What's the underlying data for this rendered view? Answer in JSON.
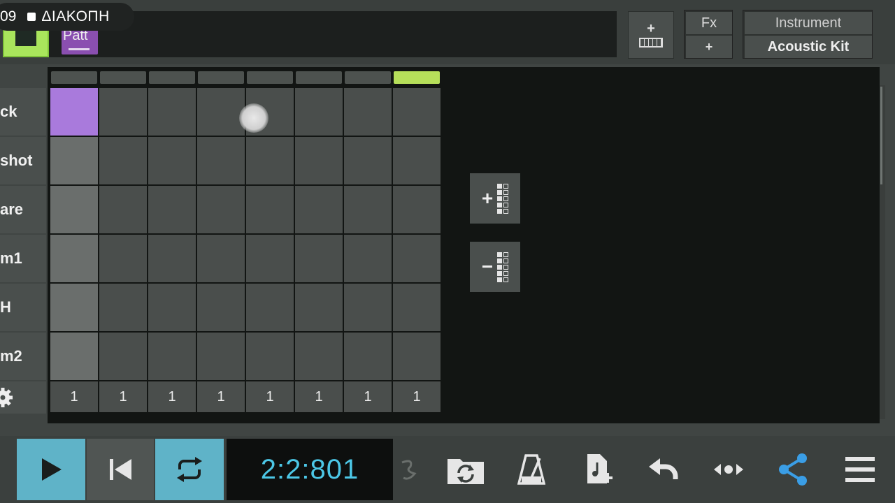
{
  "status": {
    "time": "09",
    "recording_label": "ΔΙΑΚΟΠΗ"
  },
  "pattern": {
    "chip_label": "Patt"
  },
  "header": {
    "keyboard_plus": "+",
    "fx_label": "Fx",
    "fx_plus": "+",
    "instrument_label": "Instrument",
    "instrument_name": "Acoustic Kit"
  },
  "tracks": [
    {
      "label": "ck"
    },
    {
      "label": "shot"
    },
    {
      "label": "are"
    },
    {
      "label": "m1"
    },
    {
      "label": "H"
    },
    {
      "label": "m2"
    }
  ],
  "steps": {
    "count": 8,
    "active_step": 8
  },
  "velocity_values": [
    "1",
    "1",
    "1",
    "1",
    "1",
    "1",
    "1",
    "1"
  ],
  "active_cells": [
    [
      0,
      0
    ]
  ],
  "side_buttons": {
    "add_sign": "+",
    "remove_sign": "−"
  },
  "transport": {
    "time": "2:2:801"
  },
  "colors": {
    "accent_cyan": "#5fb3c8",
    "step_active": "#b6df5a",
    "note_on": "#a97adc",
    "share_blue": "#3a9ee6"
  }
}
